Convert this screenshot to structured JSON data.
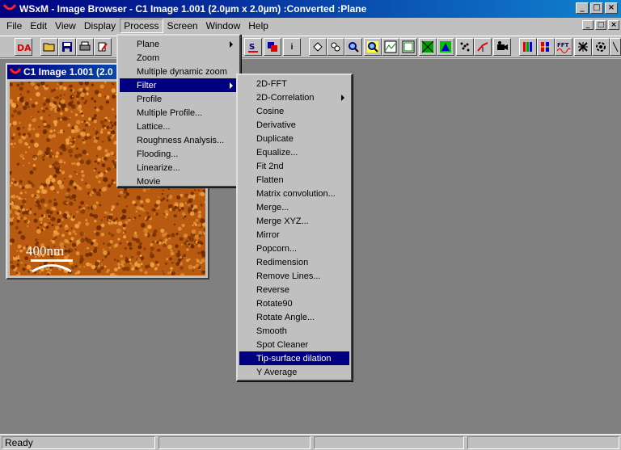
{
  "window": {
    "title": "WSxM - Image Browser - C1 Image 1.001 (2.0µm x 2.0µm) :Converted :Plane",
    "minimize": "_",
    "maximize": "□",
    "close": "×"
  },
  "menubar": {
    "items": [
      "File",
      "Edit",
      "View",
      "Display",
      "Process",
      "Screen",
      "Window",
      "Help"
    ],
    "active": "Process"
  },
  "toolbar": {
    "buttons": [
      "da-logo-icon",
      "open-icon",
      "save-icon",
      "print-icon",
      "edit-icon",
      "3d-s-icon",
      "palette-icon",
      "info-icon",
      "select-icon",
      "multi-select-icon",
      "zoom-in-icon",
      "zoom-out-icon",
      "profile-a-icon",
      "profile-b-icon",
      "grid-icon",
      "triangle-icon",
      "scatter-icon",
      "curve-icon",
      "movie-icon",
      "color-bars-icon",
      "color-bars-alt-icon",
      "fft-icon",
      "cross-icon",
      "gear-icon"
    ],
    "info_label": "i",
    "fft_label": "FFT"
  },
  "child_window": {
    "title": "C1 Image 1.001 (2.0",
    "scale_label": "400nm",
    "colors": {
      "dark": "#6b2a00",
      "mid": "#b85a10",
      "light": "#f0a040"
    }
  },
  "process_menu": {
    "items": [
      {
        "label": "Plane",
        "submenu": true
      },
      {
        "label": "Zoom",
        "submenu": false
      },
      {
        "label": "Multiple dynamic zoom",
        "submenu": false
      },
      {
        "label": "Filter",
        "submenu": true,
        "selected": true
      },
      {
        "label": "Profile",
        "submenu": false
      },
      {
        "label": "Multiple Profile...",
        "submenu": false
      },
      {
        "label": "Lattice...",
        "submenu": false
      },
      {
        "label": "Roughness Analysis...",
        "submenu": false
      },
      {
        "label": "Flooding...",
        "submenu": false
      },
      {
        "label": "Linearize...",
        "submenu": false
      },
      {
        "label": "Movie",
        "submenu": false
      }
    ]
  },
  "filter_menu": {
    "items": [
      {
        "label": "2D-FFT",
        "submenu": false
      },
      {
        "label": "2D-Correlation",
        "submenu": true
      },
      {
        "label": "Cosine",
        "submenu": false
      },
      {
        "label": "Derivative",
        "submenu": false
      },
      {
        "label": "Duplicate",
        "submenu": false
      },
      {
        "label": "Equalize...",
        "submenu": false
      },
      {
        "label": "Fit 2nd",
        "submenu": false
      },
      {
        "label": "Flatten",
        "submenu": false
      },
      {
        "label": "Matrix convolution...",
        "submenu": false
      },
      {
        "label": "Merge...",
        "submenu": false
      },
      {
        "label": "Merge XYZ...",
        "submenu": false
      },
      {
        "label": "Mirror",
        "submenu": false
      },
      {
        "label": "Popcorn...",
        "submenu": false
      },
      {
        "label": "Redimension",
        "submenu": false
      },
      {
        "label": "Remove Lines...",
        "submenu": false
      },
      {
        "label": "Reverse",
        "submenu": false
      },
      {
        "label": "Rotate90",
        "submenu": false
      },
      {
        "label": "Rotate Angle...",
        "submenu": false
      },
      {
        "label": "Smooth",
        "submenu": false
      },
      {
        "label": "Spot Cleaner",
        "submenu": false
      },
      {
        "label": "Tip-surface  dilation",
        "submenu": false,
        "selected": true
      },
      {
        "label": "Y Average",
        "submenu": false
      }
    ]
  },
  "statusbar": {
    "text": "Ready"
  }
}
